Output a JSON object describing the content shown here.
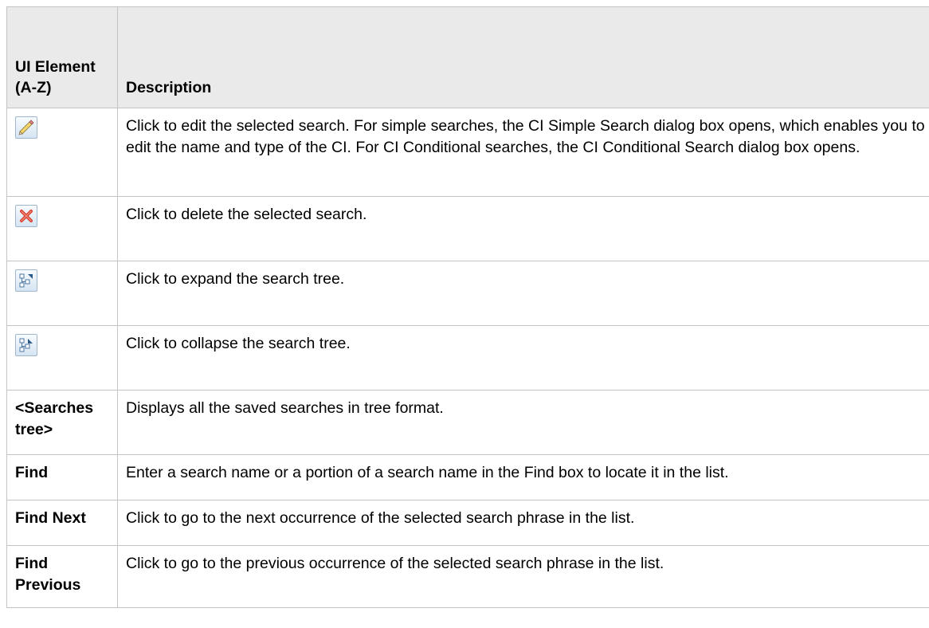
{
  "header": {
    "col1": "UI Element (A-Z)",
    "col2": "Description"
  },
  "rows": [
    {
      "icon": "edit-pencil-icon",
      "description": "Click to edit the selected search. For simple searches, the CI Simple Search dialog box opens, which enables you to edit the name and type of the CI. For CI Conditional searches, the CI Conditional Search dialog box opens."
    },
    {
      "icon": "delete-x-icon",
      "description": "Click to delete the selected search."
    },
    {
      "icon": "expand-tree-icon",
      "description": "Click to expand the search tree."
    },
    {
      "icon": "collapse-tree-icon",
      "description": "Click to collapse the search tree."
    },
    {
      "element": "<Searches tree>",
      "description": "Displays all the saved searches in tree format."
    },
    {
      "element": "Find",
      "description": "Enter a search name or a portion of a search name in the Find box to locate it in the list."
    },
    {
      "element": "Find Next",
      "description": "Click to go to the next occurrence of the selected search phrase in the list."
    },
    {
      "element": "Find Previous",
      "description": "Click to go to the previous occurrence of the selected search phrase in the list."
    }
  ]
}
